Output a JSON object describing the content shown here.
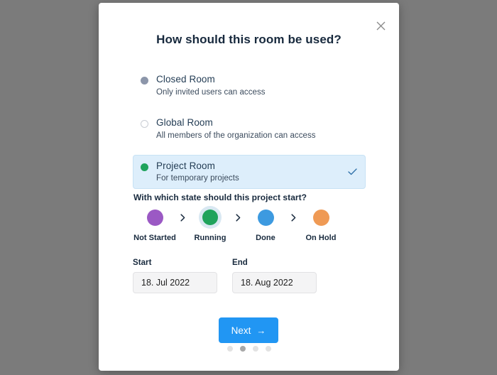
{
  "modal": {
    "title": "How should this room be used?",
    "close_icon": "close-icon"
  },
  "room_options": [
    {
      "label": "Closed Room",
      "description": "Only invited users can access",
      "bullet_color": "#8c96aa",
      "selected": false
    },
    {
      "label": "Global Room",
      "description": "All members of the organization can access",
      "bullet_color": "#ffffff",
      "selected": false
    },
    {
      "label": "Project Room",
      "description": "For temporary projects",
      "bullet_color": "#1fa35c",
      "selected": true
    }
  ],
  "state_section": {
    "question": "With which state should this project start?",
    "separator": "chevron-right-icon",
    "states": [
      {
        "label": "Not Started",
        "color": "#9b59c4",
        "active": false
      },
      {
        "label": "Running",
        "color": "#1fa35c",
        "active": true
      },
      {
        "label": "Done",
        "color": "#3d9ae0",
        "active": false
      },
      {
        "label": "On Hold",
        "color": "#ef9a55",
        "active": false
      }
    ]
  },
  "dates": {
    "start": {
      "label": "Start",
      "value": "18. Jul 2022"
    },
    "end": {
      "label": "End",
      "value": "18. Aug 2022"
    }
  },
  "footer": {
    "next_label": "Next",
    "next_arrow": "→",
    "next_color": "#2196f3",
    "pagination": {
      "total": 4,
      "active_index": 1
    }
  }
}
